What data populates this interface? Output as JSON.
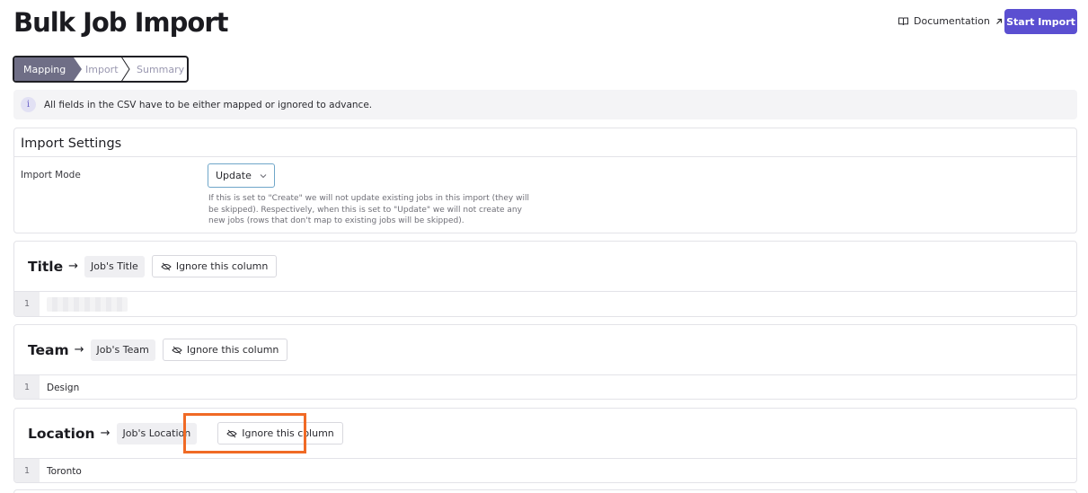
{
  "header": {
    "title": "Bulk Job Import",
    "documentation_label": "Documentation",
    "start_import_label": "Start Import"
  },
  "stepper": {
    "steps": [
      {
        "label": "Mapping",
        "active": true
      },
      {
        "label": "Import",
        "active": false
      },
      {
        "label": "Summary",
        "active": false
      }
    ]
  },
  "info": {
    "icon": "info-icon",
    "text": "All fields in the CSV have to be either mapped or ignored to advance."
  },
  "settings": {
    "title": "Import Settings",
    "mode_label": "Import Mode",
    "mode_value": "Update",
    "help_text": "If this is set to \"Create\" we will not update existing jobs in this import (they will be skipped). Respectively, when this is set to \"Update\" we will not create any new jobs (rows that don't map to existing jobs will be skipped)."
  },
  "columns": [
    {
      "name": "Title",
      "arrow": "→",
      "field": "Job's Title",
      "ignore_label": "Ignore this column",
      "rows": [
        {
          "num": "1",
          "value": ""
        }
      ]
    },
    {
      "name": "Team",
      "arrow": "→",
      "field": "Job's Team",
      "ignore_label": "Ignore this column",
      "rows": [
        {
          "num": "1",
          "value": "Design"
        }
      ]
    },
    {
      "name": "Location",
      "arrow": "→",
      "field": "Job's Location",
      "ignore_label": "Ignore this column",
      "rows": [
        {
          "num": "1",
          "value": "Toronto"
        }
      ]
    }
  ],
  "colors": {
    "accent": "#5b4fd1",
    "highlight": "#f06a25",
    "step_active": "#6f6e86"
  }
}
